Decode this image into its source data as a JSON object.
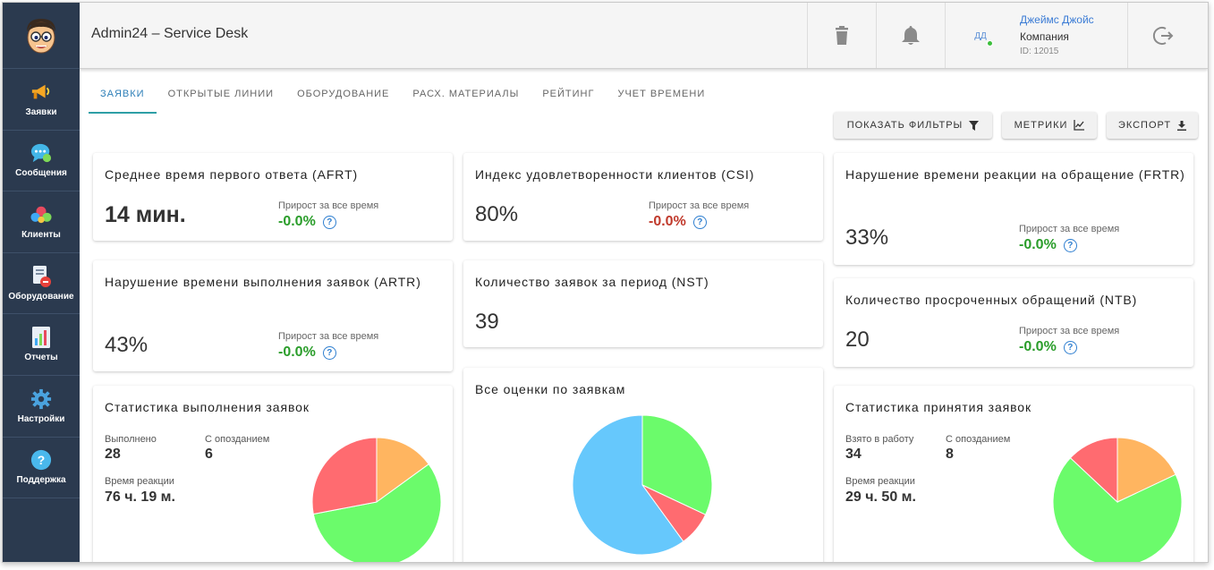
{
  "app": {
    "title": "Admin24 – Service Desk"
  },
  "sidebar": {
    "items": [
      {
        "label": "Заявки",
        "icon": "megaphone-icon"
      },
      {
        "label": "Сообщения",
        "icon": "chat-bubble-icon"
      },
      {
        "label": "Клиенты",
        "icon": "clients-icon"
      },
      {
        "label": "Оборудование",
        "icon": "equipment-icon"
      },
      {
        "label": "Отчеты",
        "icon": "report-icon"
      },
      {
        "label": "Настройки",
        "icon": "gear-icon"
      },
      {
        "label": "Поддержка",
        "icon": "help-icon"
      }
    ]
  },
  "user": {
    "initials": "ДД",
    "name": "Джеймс Джойс",
    "company": "Компания",
    "id": "ID: 12015"
  },
  "tabs": [
    "ЗАЯВКИ",
    "ОТКРЫТЫЕ ЛИНИИ",
    "ОБОРУДОВАНИЕ",
    "РАСХ. МАТЕРИАЛЫ",
    "РЕЙТИНГ",
    "УЧЕТ ВРЕМЕНИ"
  ],
  "toolbar": {
    "filters": "ПОКАЗАТЬ ФИЛЬТРЫ",
    "metrics": "МЕТРИКИ",
    "export": "ЭКСПОРТ"
  },
  "growth_label": "Прирост за все время",
  "metrics": {
    "afrt": {
      "title": "Среднее время первого ответа (AFRT)",
      "value": "14 мин.",
      "growth": "-0.0%",
      "growth_color": "#2a9d2a"
    },
    "csi": {
      "title": "Индекс удовлетворенности клиентов (CSI)",
      "value": "80%",
      "growth": "-0.0%",
      "growth_color": "#c0392b"
    },
    "frtr": {
      "title": "Нарушение времени реакции на обращение (FRTR)",
      "value": "33%",
      "growth": "-0.0%",
      "growth_color": "#2a9d2a"
    },
    "artr": {
      "title": "Нарушение времени выполнения заявок (ARTR)",
      "value": "43%",
      "growth": "-0.0%",
      "growth_color": "#2a9d2a"
    },
    "nst": {
      "title": "Количество заявок за период (NST)",
      "value": "39"
    },
    "ntb": {
      "title": "Количество просроченных обращений (NTB)",
      "value": "20",
      "growth": "-0.0%",
      "growth_color": "#2a9d2a"
    }
  },
  "completion": {
    "title": "Статистика выполнения заявок",
    "done_label": "Выполнено",
    "done_value": "28",
    "late_label": "С опозданием",
    "late_value": "6",
    "reaction_label": "Время реакции",
    "reaction_value": "76 ч. 19 м."
  },
  "acceptance": {
    "title": "Статистика принятия заявок",
    "taken_label": "Взято в работу",
    "taken_value": "34",
    "late_label": "С опозданием",
    "late_value": "8",
    "reaction_label": "Время реакции",
    "reaction_value": "29 ч. 50 м."
  },
  "ratings": {
    "title": "Все оценки по заявкам"
  },
  "chart_data": [
    {
      "type": "pie",
      "chart": "completion",
      "values": [
        15,
        57,
        28
      ],
      "colors": [
        "#ffb560",
        "#6bfb6b",
        "#ff6b70"
      ]
    },
    {
      "type": "pie",
      "chart": "ratings",
      "values": [
        32,
        8,
        60
      ],
      "colors": [
        "#6bfb6b",
        "#ff6b70",
        "#66c8fc"
      ]
    },
    {
      "type": "pie",
      "chart": "acceptance",
      "values": [
        18,
        69,
        13
      ],
      "colors": [
        "#ffb560",
        "#6bfb6b",
        "#ff6b70"
      ]
    }
  ]
}
